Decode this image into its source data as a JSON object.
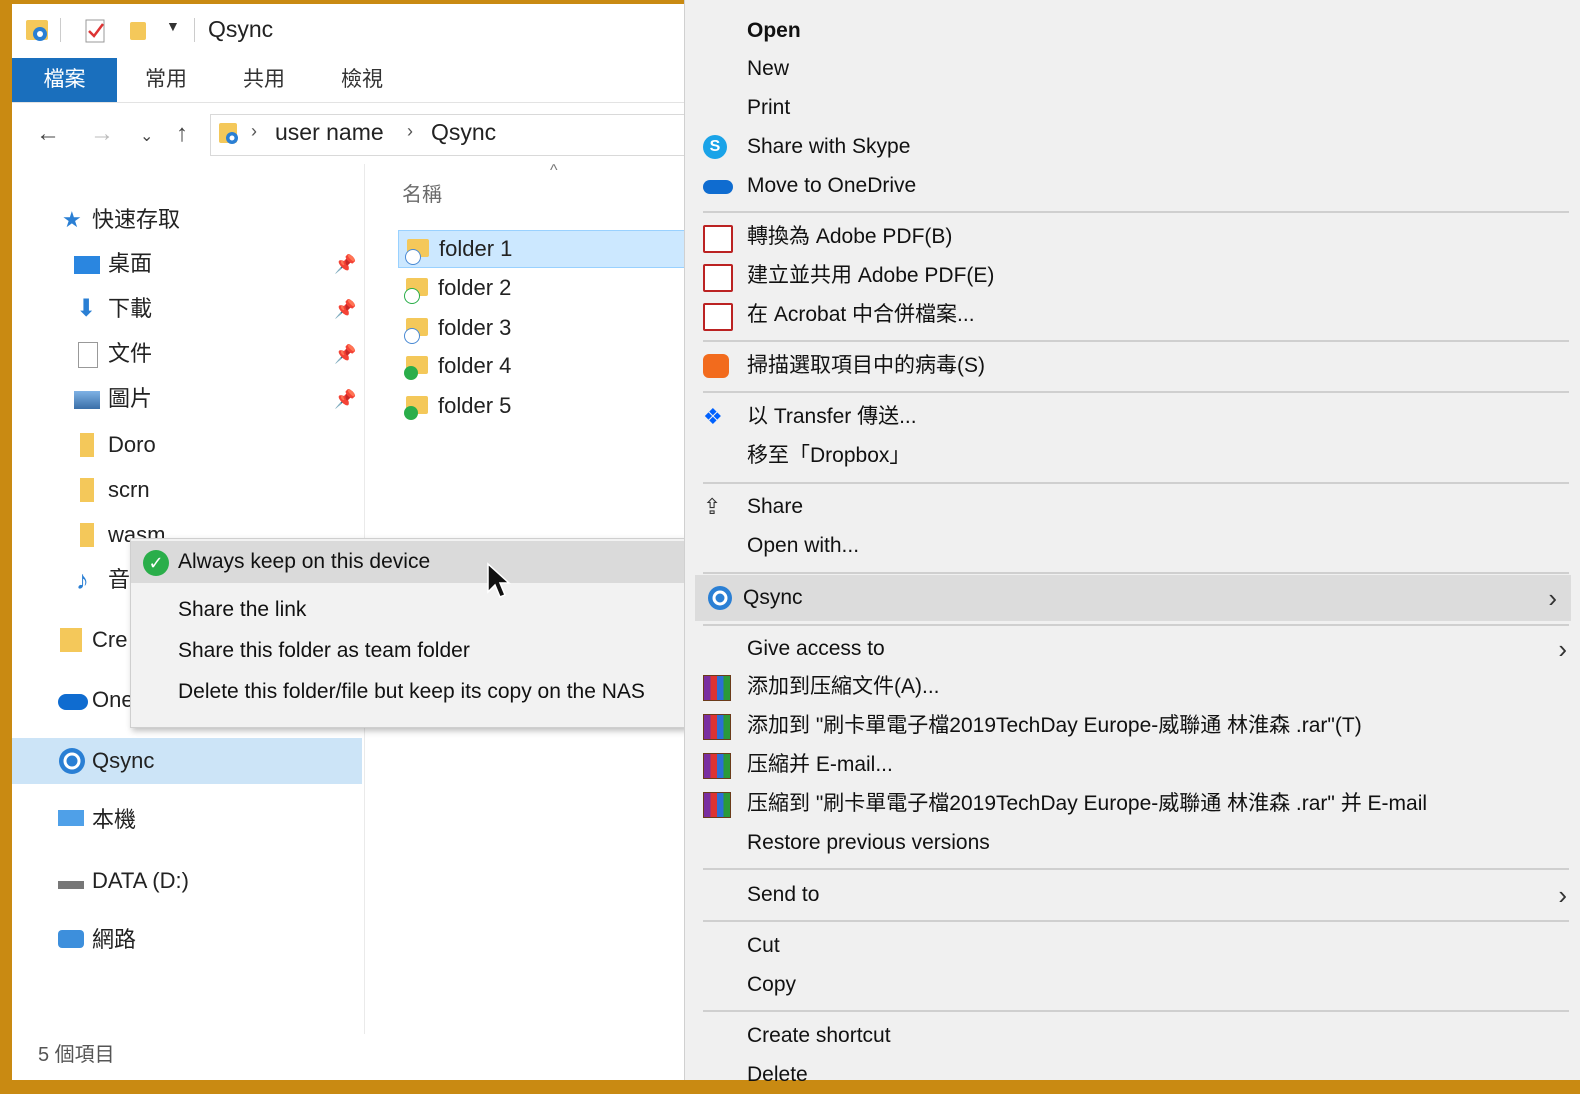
{
  "explorer": {
    "title": "Qsync",
    "ribbon_tabs": [
      "檔案",
      "常用",
      "共用",
      "檢視"
    ],
    "breadcrumb": [
      "user name",
      "Qsync"
    ],
    "nav": {
      "quick_access": "快速存取",
      "items": [
        "桌面",
        "下載",
        "文件",
        "圖片",
        "Doro",
        "scrn",
        "wasm",
        "音",
        "Cre",
        "One",
        "Qsync",
        "本機",
        "DATA (D:)",
        "網路"
      ]
    },
    "column_header": "名稱",
    "files": [
      "folder 1",
      "folder 2",
      "folder 3",
      "folder 4",
      "folder 5"
    ],
    "status": "5 個項目"
  },
  "submenu": {
    "items": [
      "Always keep on this device",
      "Share the link",
      "Share this folder as team folder",
      "Delete this folder/file but keep its copy on the NAS"
    ]
  },
  "context_menu": {
    "items": [
      "Open",
      "New",
      "Print",
      "Share with Skype",
      "Move to OneDrive",
      "轉換為 Adobe PDF(B)",
      "建立並共用 Adobe PDF(E)",
      "在 Acrobat 中合併檔案...",
      "掃描選取項目中的病毒(S)",
      "以 Transfer 傳送...",
      "移至「Dropbox」",
      "Share",
      "Open with...",
      "Qsync",
      "Give access to",
      "添加到压縮文件(A)...",
      "添加到 \"刷卡單電子檔2019TechDay Europe-威聯通 林淮森 .rar\"(T)",
      "压縮并 E-mail...",
      "压縮到 \"刷卡單電子檔2019TechDay Europe-威聯通 林淮森 .rar\" 并 E-mail",
      "Restore previous versions",
      "Send to",
      "Cut",
      "Copy",
      "Create shortcut",
      "Delete"
    ]
  },
  "colors": {
    "accent": "#1a6fbd",
    "selection": "#cce8ff",
    "menu_bg": "#f0f0f0",
    "border": "#c98a12"
  }
}
